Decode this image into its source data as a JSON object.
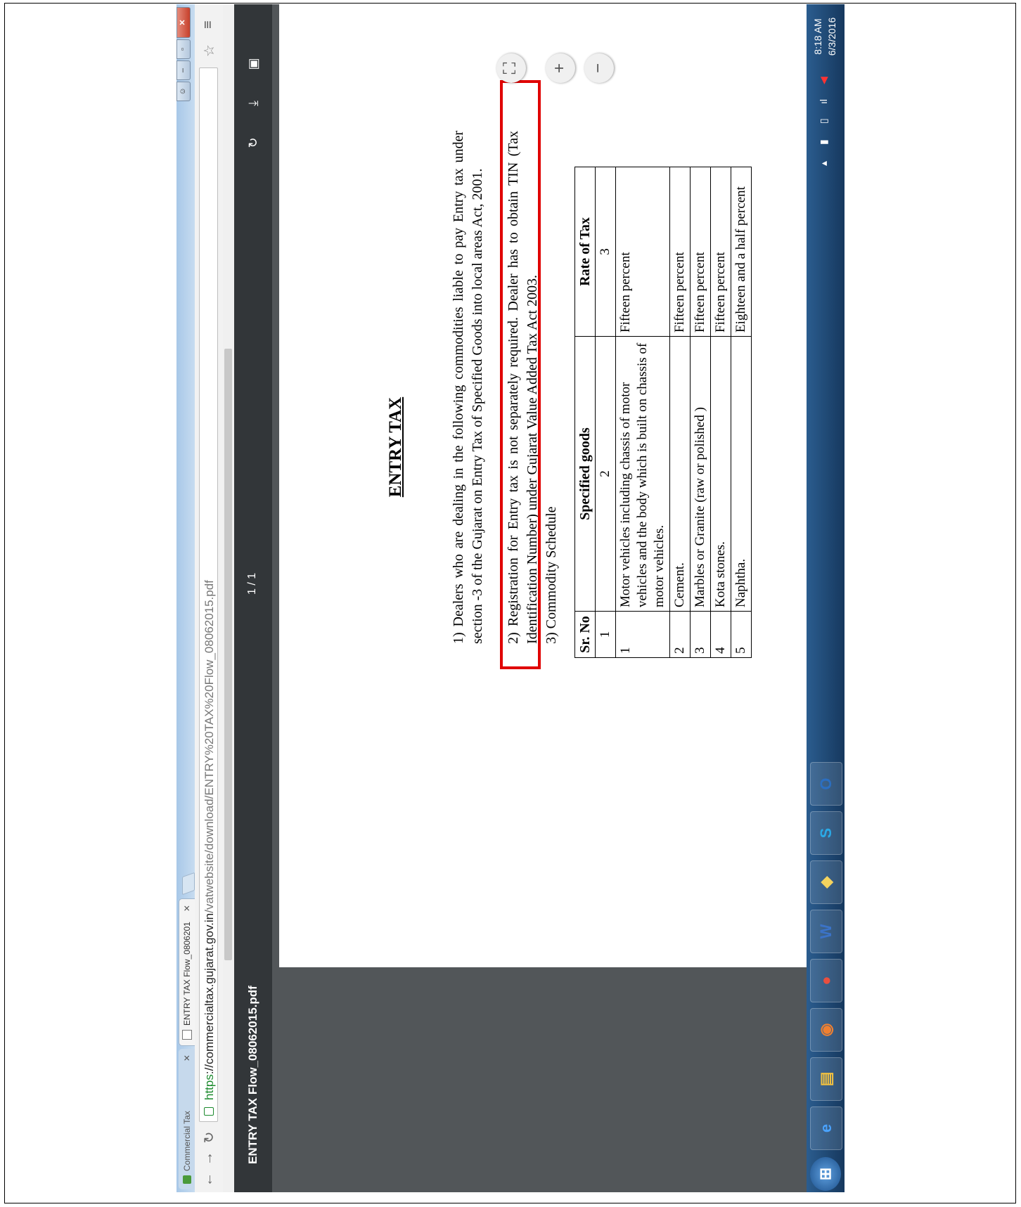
{
  "browser": {
    "tabs": [
      {
        "label": "Commercial Tax",
        "active": false
      },
      {
        "label": "ENTRY TAX Flow_0806201",
        "active": true
      }
    ],
    "url_scheme": "https",
    "url_host": "://commercialtax.gujarat.gov.in",
    "url_path": "/vatwebsite/download/ENTRY%20TAX%20Flow_08062015.pdf"
  },
  "pdf_viewer": {
    "file_name": "ENTRY TAX Flow_08062015.pdf",
    "page_indicator": "1 / 1"
  },
  "document": {
    "title": "ENTRY TAX",
    "para1": "1) Dealers who are dealing in the following commodities liable to pay Entry tax under section -3 of the Gujarat on Entry Tax of Specified Goods into local areas Act, 2001.",
    "para2": "2) Registration for Entry tax is not separately required. Dealer has to obtain TIN (Tax Identification Number) under Gujarat Value Added Tax Act 2003.",
    "para3": "3) Commodity Schedule",
    "table": {
      "headers": [
        "Sr. No",
        "Specified goods",
        "Rate of Tax"
      ],
      "index_row": [
        "1",
        "2",
        "3"
      ],
      "rows": [
        {
          "sr": "1",
          "goods": "Motor vehicles including chassis of motor vehicles and the body which is built on chassis of motor vehicles.",
          "rate": "Fifteen percent"
        },
        {
          "sr": "2",
          "goods": "Cement.",
          "rate": "Fifteen percent"
        },
        {
          "sr": "3",
          "goods": "Marbles or Granite (raw or polished )",
          "rate": "Fifteen percent"
        },
        {
          "sr": "4",
          "goods": "Kota stones.",
          "rate": "Fifteen percent"
        },
        {
          "sr": "5",
          "goods": "Naphtha.",
          "rate": "Eighteen and a half percent"
        }
      ]
    }
  },
  "taskbar": {
    "time": "8:18 AM",
    "date": "6/3/2016"
  },
  "colors": {
    "highlight_box": "#e00000",
    "pdf_toolbar": "#323639",
    "viewer_bg": "#525659"
  }
}
